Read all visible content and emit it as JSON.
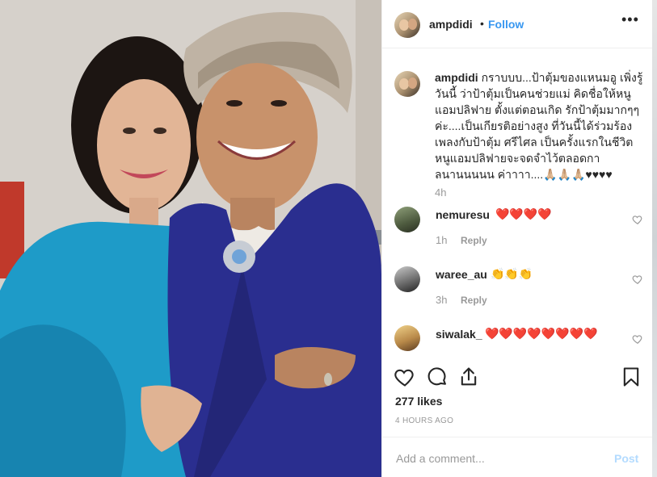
{
  "post": {
    "username": "ampdidi",
    "follow_label": "Follow",
    "dot": "•",
    "more_label": "•••",
    "caption_username": "ampdidi",
    "caption_text": "กราบบบ...ป้าตุ้มของแหนมอู เพิ่งรู้วันนี้ ว่าป้าตุ้มเป็นคนช่วยแม่ คิดชื่อให้หนูแอมปลิฟาย ตั้งแต่ตอนเกิด รักป้าตุ้มมากๆๆ ค่ะ....เป็นเกียรติอย่างสูง ที่วันนี้ได้ร่วมร้องเพลงกับป้าตุ้ม ศรีไศล เป็นครั้งแรกในชีวิต หนูแอมปลิฟายจะจดจำไว้ตลอดกาลนานนนนน ค่าาาา....🙏🏼🙏🏼🙏🏼♥♥♥♥",
    "caption_time": "4h",
    "likes": "277 likes",
    "posted_ago": "4 HOURS AGO"
  },
  "comments": [
    {
      "username": "nemuresu",
      "text": "❤️❤️❤️❤️",
      "time": "1h",
      "reply_label": "Reply"
    },
    {
      "username": "waree_au",
      "text": "👏👏👏",
      "time": "3h",
      "reply_label": "Reply"
    },
    {
      "username": "siwalak_",
      "text": "❤️❤️❤️❤️❤️❤️❤️❤️",
      "time": "",
      "reply_label": ""
    }
  ],
  "actions": {
    "like": "heart-outline-icon",
    "comment": "comment-bubble-icon",
    "share": "share-icon",
    "save": "bookmark-icon"
  },
  "comment_box": {
    "placeholder": "Add a comment...",
    "post_label": "Post"
  },
  "colors": {
    "accent": "#3897f0",
    "post_disabled": "#b3dbff",
    "muted": "#999999",
    "heart_red": "#e0245e"
  }
}
